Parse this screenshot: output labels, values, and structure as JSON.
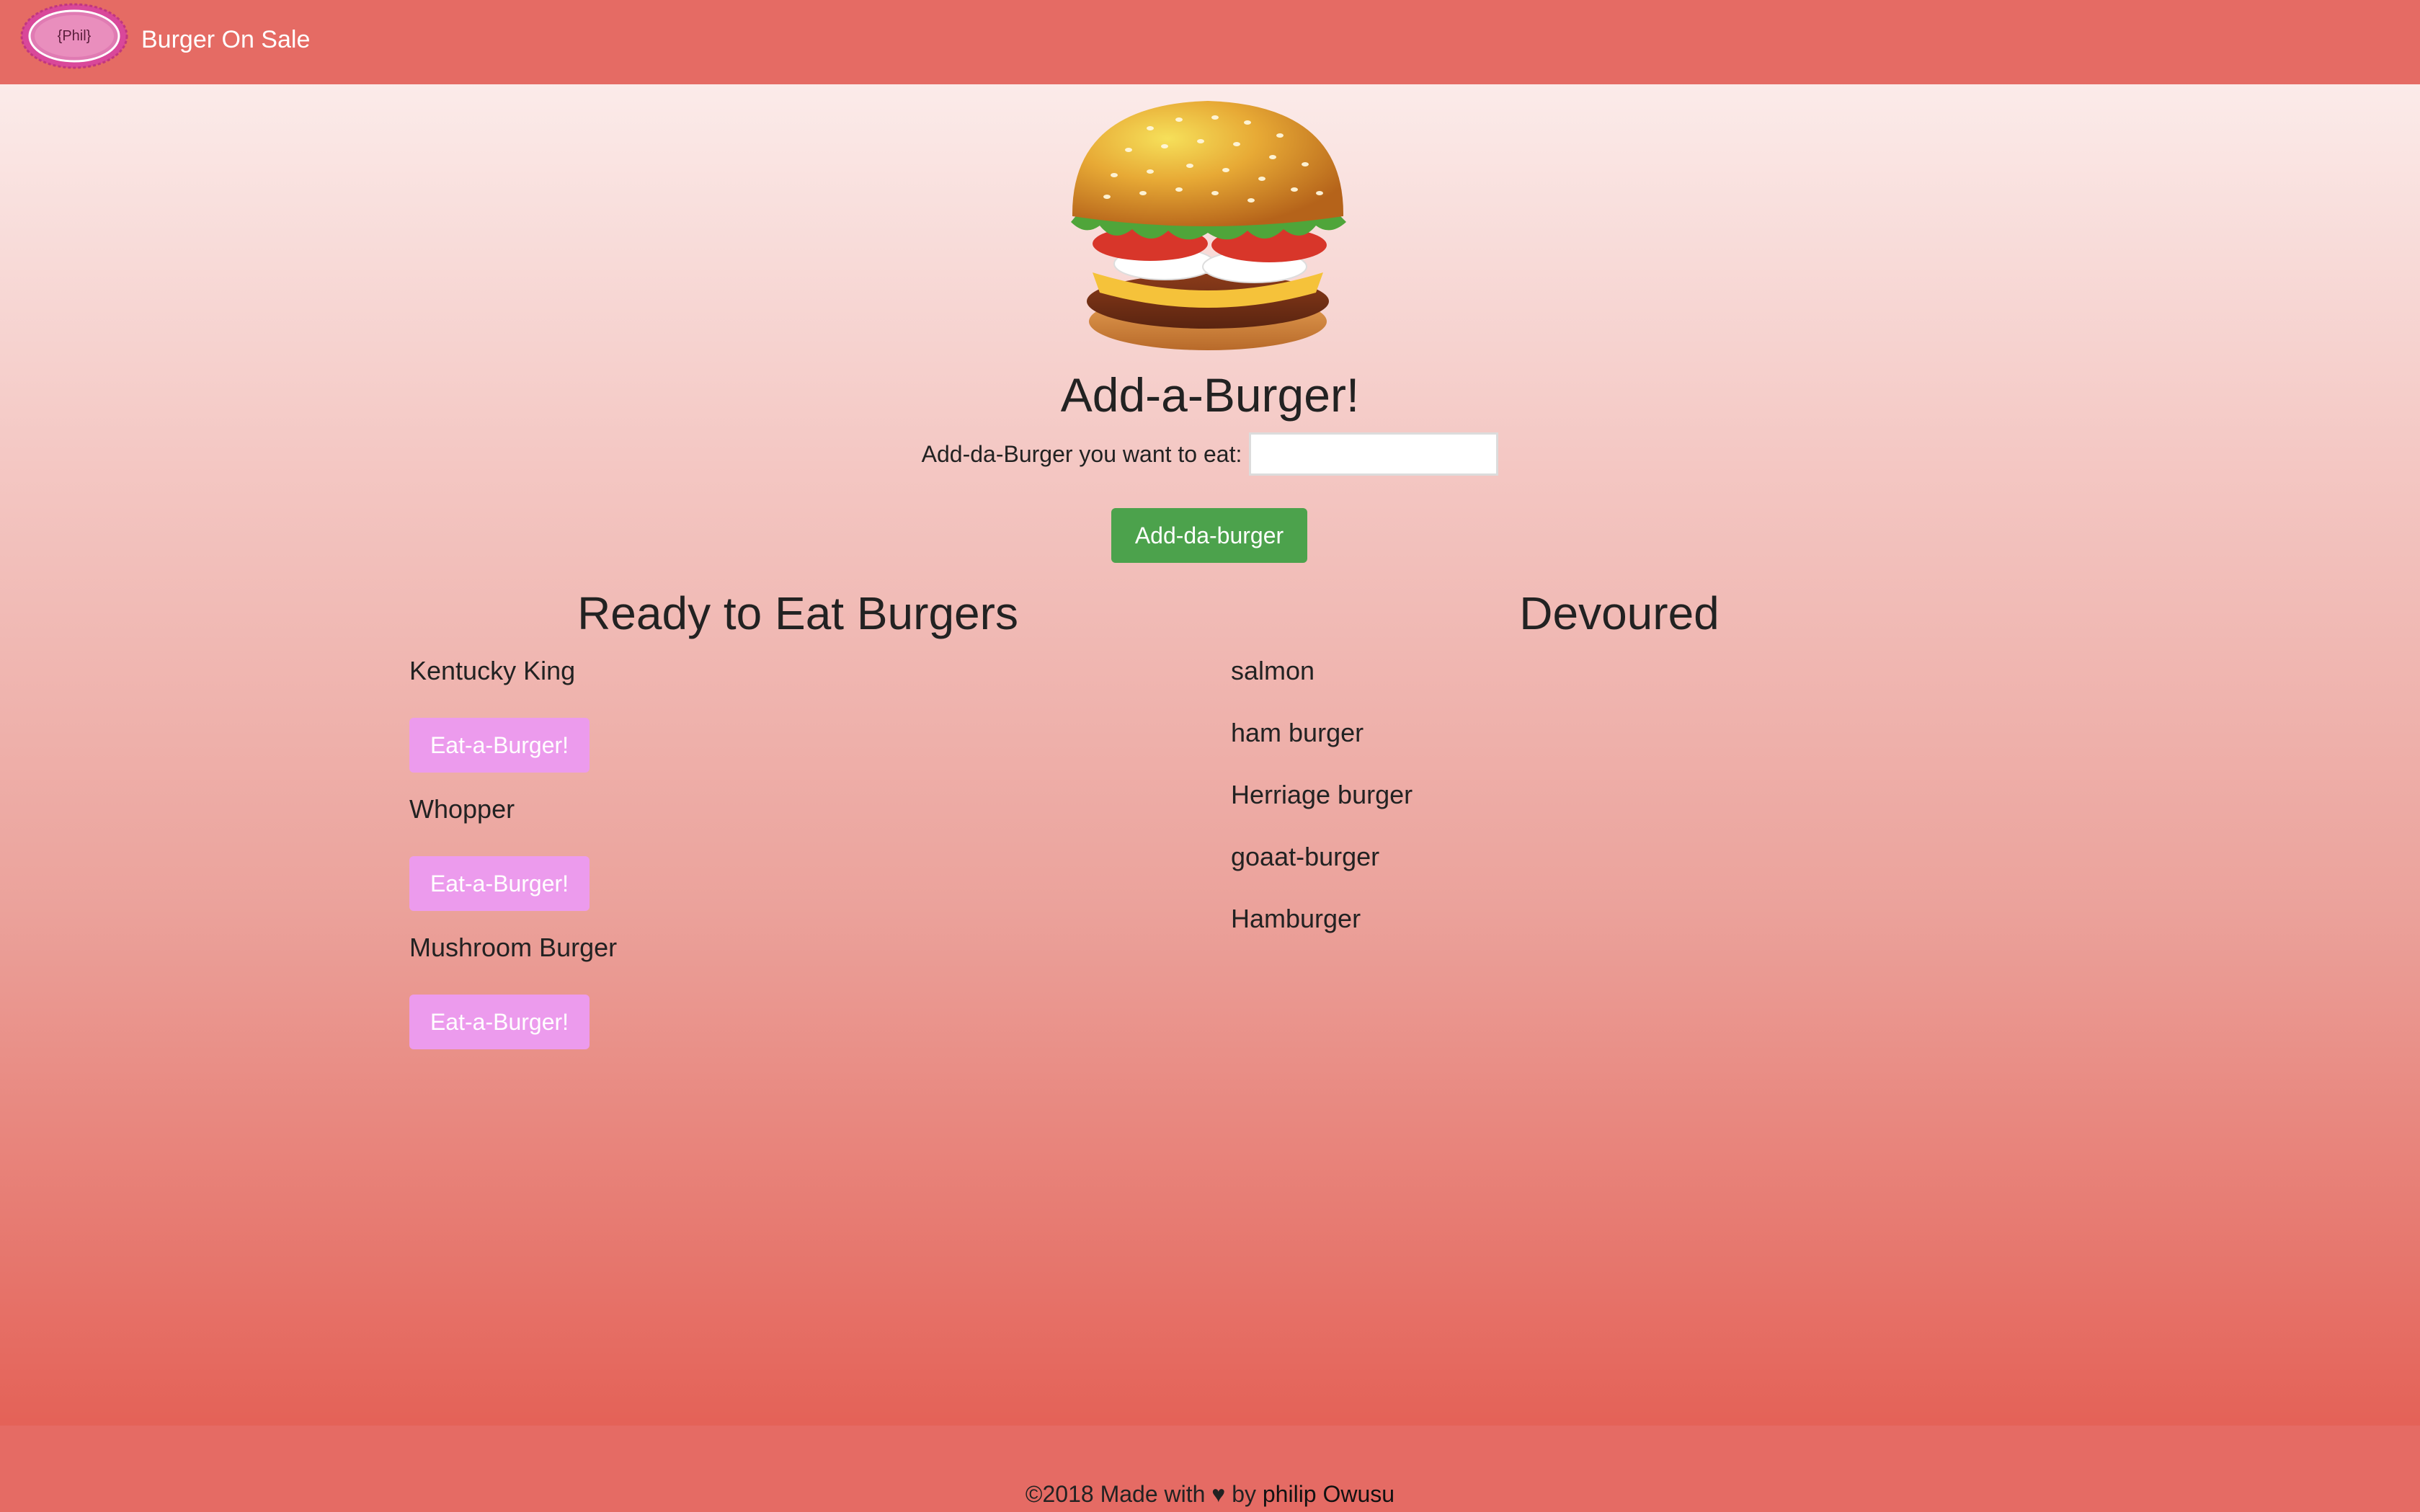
{
  "navbar": {
    "logo_text": "{Phil}",
    "brand": "Burger On Sale"
  },
  "hero": {
    "image": "burger-illustration"
  },
  "form": {
    "title": "Add-a-Burger!",
    "label": "Add-da-Burger you want to eat:",
    "input_value": "",
    "input_placeholder": "",
    "submit_label": "Add-da-burger"
  },
  "ready": {
    "heading": "Ready to Eat Burgers",
    "button_label": "Eat-a-Burger!",
    "items": [
      {
        "name": "Kentucky King"
      },
      {
        "name": "Whopper"
      },
      {
        "name": "Mushroom Burger"
      }
    ]
  },
  "devoured": {
    "heading": "Devoured",
    "items": [
      {
        "name": "salmon"
      },
      {
        "name": "ham burger"
      },
      {
        "name": "Herriage burger"
      },
      {
        "name": "goaat-burger"
      },
      {
        "name": "Hamburger"
      }
    ]
  },
  "footer": {
    "prefix": "©2018 Made with ",
    "heart": "♥",
    "by": " by ",
    "author": "philip Owusu"
  },
  "colors": {
    "navbar": "#e56b64",
    "add_button": "#4ca24c",
    "eat_button": "#ec9bed"
  }
}
